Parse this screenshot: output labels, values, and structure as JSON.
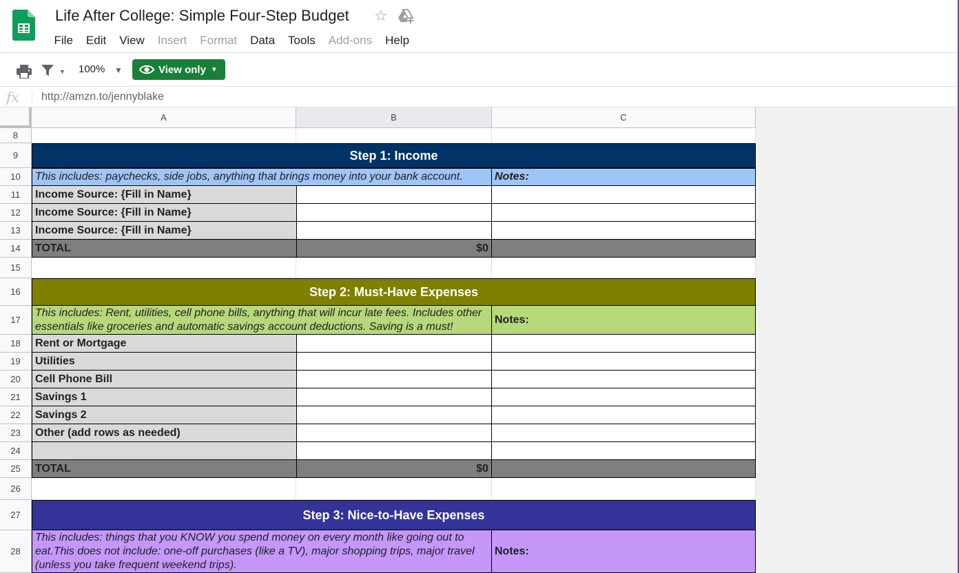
{
  "header": {
    "title": "Life After College: Simple Four-Step Budget",
    "menu": [
      {
        "label": "File",
        "disabled": false
      },
      {
        "label": "Edit",
        "disabled": false
      },
      {
        "label": "View",
        "disabled": false
      },
      {
        "label": "Insert",
        "disabled": true
      },
      {
        "label": "Format",
        "disabled": true
      },
      {
        "label": "Data",
        "disabled": false
      },
      {
        "label": "Tools",
        "disabled": false
      },
      {
        "label": "Add-ons",
        "disabled": true
      },
      {
        "label": "Help",
        "disabled": false
      }
    ]
  },
  "toolbar": {
    "zoom": "100%",
    "view_only_label": "View only"
  },
  "formula_bar": {
    "fx": "fx",
    "content": "http://amzn.to/jennyblake"
  },
  "columns": [
    "A",
    "B",
    "C"
  ],
  "rows": {
    "r8": "8",
    "r9": "9",
    "r10": "10",
    "r11": "11",
    "r12": "12",
    "r13": "13",
    "r14": "14",
    "r15": "15",
    "r16": "16",
    "r17": "17",
    "r18": "18",
    "r19": "19",
    "r20": "20",
    "r21": "21",
    "r22": "22",
    "r23": "23",
    "r24": "24",
    "r25": "25",
    "r26": "26",
    "r27": "27",
    "r28": "28"
  },
  "sheet": {
    "step1": {
      "title": "Step 1: Income",
      "desc": "This includes: paychecks, side jobs, anything that brings money into your bank account.",
      "notes": "Notes:",
      "items": [
        "Income Source: {Fill in Name}",
        "Income Source: {Fill in Name}",
        "Income Source: {Fill in Name}"
      ],
      "total_label": "TOTAL",
      "total_value": "$0"
    },
    "step2": {
      "title": "Step 2: Must-Have Expenses",
      "desc": "This includes: Rent, utilities, cell phone bills, anything that will incur late fees. Includes other essentials like groceries and automatic savings account deductions. Saving is a must!",
      "notes": "Notes:",
      "items": [
        "Rent or Mortgage",
        "Utilities",
        "Cell Phone Bill",
        "Savings 1",
        "Savings 2",
        "Other (add rows as needed)",
        ""
      ],
      "total_label": "TOTAL",
      "total_value": "$0"
    },
    "step3": {
      "title": "Step 3: Nice-to-Have Expenses",
      "desc": "This includes: things that you KNOW you spend money on every month like going out to eat.This does not include: one-off purchases (like a TV), major shopping trips, major travel (unless you take frequent weekend trips).",
      "notes": "Notes:"
    }
  },
  "colors": {
    "step1_banner": "#003366",
    "step1_desc": "#9fc5f8",
    "step2_banner": "#7f7f00",
    "step2_desc": "#b6d77a",
    "step3_banner": "#333399",
    "step3_desc": "#c497f8",
    "label_cell": "#d9d9d9",
    "total_row": "#7f7f7f",
    "view_only": "#188038"
  }
}
